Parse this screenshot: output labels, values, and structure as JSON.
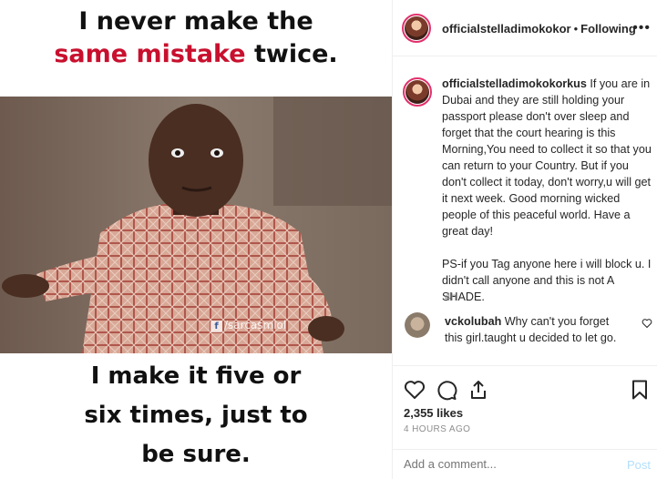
{
  "meme": {
    "top_line1": "I never make the",
    "top_line2_red": "same mistake",
    "top_line2_rest": " twice.",
    "bottom_line1": "I make it five or",
    "bottom_line2": "six times, just to",
    "bottom_line3": "be sure.",
    "watermark": "/sarcasmlol"
  },
  "header": {
    "username": "officialstelladimokokor",
    "dot": "•",
    "follow_status": "Following",
    "more": "•••"
  },
  "caption": {
    "username": "officialstelladimokokorkus",
    "text1": " If you are in Dubai and they are still holding your passport please don't over sleep and forget that the court hearing is this Morning,You need to collect it so that you can return to your Country. But if you don't collect it today, don't worry,u will get it next week. Good morning wicked people of this peaceful world. Have a great day!",
    "text2": "PS-if you Tag anyone here i will block u. I didn't call anyone and this is not A SHADE.",
    "time": "4h"
  },
  "comment": {
    "username": "vckolubah",
    "text": " Why can't you forget this girl.taught u decided to let go."
  },
  "stats": {
    "likes": "2,355 likes",
    "ago": "4 HOURS AGO"
  },
  "add_comment": {
    "placeholder": "Add a comment...",
    "post": "Post"
  },
  "colors": {
    "accent_red": "#c8102e",
    "post_disabled": "#b2dffc",
    "story_ring": "#e1306c"
  }
}
